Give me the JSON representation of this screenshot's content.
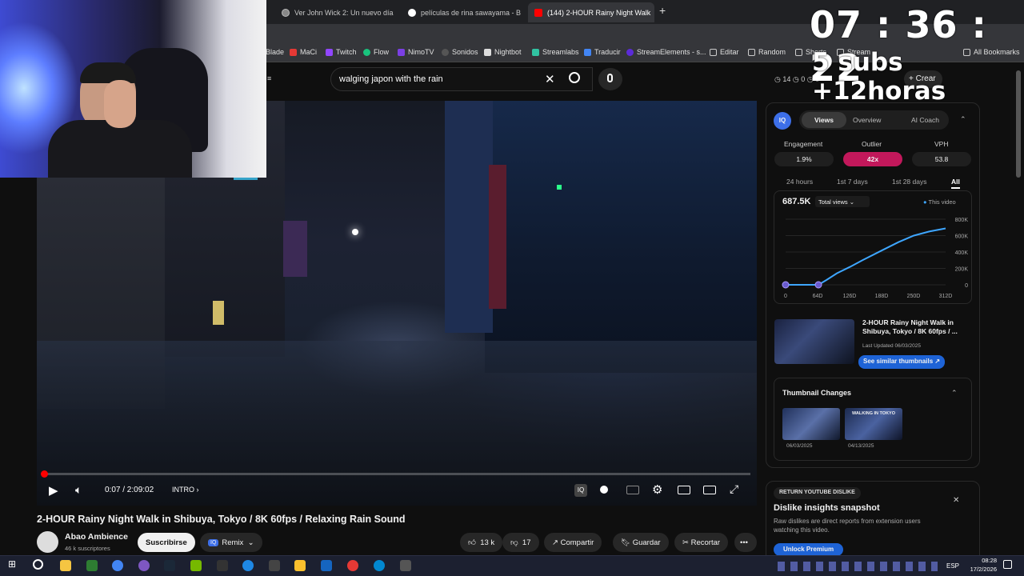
{
  "browser": {
    "tabs": [
      {
        "label": "Ver John Wick 2: Un nuevo día"
      },
      {
        "label": "películas de rina sawayama - B"
      },
      {
        "label": "(144) 2-HOUR Rainy Night Walk"
      }
    ],
    "bookmarks": [
      "Blade",
      "MaCi",
      "Twitch",
      "Flow",
      "NimoTV",
      "Sonidos",
      "Nightbot",
      "Streamlabs",
      "Traducir",
      "StreamElements - s...",
      "Editar",
      "Random",
      "Shorts",
      "Stream"
    ],
    "all_bookmarks": "All Bookmarks"
  },
  "youtube": {
    "search_value": "walging japon with the rain",
    "header_counts": {
      "a": "14",
      "b": "0",
      "c": "0"
    },
    "create_label": "Crear"
  },
  "player": {
    "time": "0:07 / 2:09:02",
    "chapter": "INTRO",
    "progress_fraction": 0.001
  },
  "video": {
    "title": "2-HOUR Rainy Night Walk in Shibuya, Tokyo / 8K 60fps / Relaxing Rain Sound",
    "channel": "Abao Ambience",
    "subscribers": "46 k suscriptores",
    "subscribe_label": "Suscribirse",
    "remix_label": "Remix",
    "likes": "13 k",
    "dislikes": "17",
    "share_label": "Compartir",
    "save_label": "Guardar",
    "clip_label": "Recortar"
  },
  "panel": {
    "logo": "IQ",
    "tabs": [
      "Views",
      "Overview",
      "AI Coach"
    ],
    "metrics": [
      {
        "label": "Engagement",
        "value": "1.9%"
      },
      {
        "label": "Outlier",
        "value": "42x"
      },
      {
        "label": "VPH",
        "value": "53.8"
      }
    ],
    "ranges": [
      "24 hours",
      "1st 7 days",
      "1st 28 days",
      "All"
    ],
    "total": "687.5K",
    "total_select": "Total views",
    "legend": "This video",
    "video_title": "2-HOUR Rainy Night Walk in Shibuya, Tokyo / 8K 60fps / ...",
    "last_updated": "Last Updated 06/03/2025",
    "similar_label": "See similar thumbnails",
    "thumb_changes_title": "Thumbnail Changes",
    "thumb_dates": [
      "06/03/2025",
      "04/13/2025"
    ],
    "thumb_text": "WALKING IN TOKYO"
  },
  "chart_data": {
    "type": "line",
    "x_ticks": [
      "0",
      "64D",
      "126D",
      "188D",
      "250D",
      "312D"
    ],
    "y_ticks": [
      "800K",
      "600K",
      "400K",
      "200K",
      "0"
    ],
    "xlim": [
      0,
      312
    ],
    "ylim": [
      0,
      800000
    ],
    "series": [
      {
        "name": "This video",
        "x": [
          0,
          30,
          64,
          80,
          100,
          126,
          150,
          188,
          220,
          250,
          280,
          312
        ],
        "y": [
          0,
          0,
          0,
          60000,
          140000,
          220000,
          300000,
          420000,
          520000,
          600000,
          650000,
          687500
        ]
      }
    ],
    "color": "#3ea6ff"
  },
  "dislike": {
    "badge": "RETURN YOUTUBE DISLIKE",
    "title": "Dislike insights snapshot",
    "desc": "Raw dislikes are direct reports from extension users watching this video.",
    "cta": "Unlock Premium"
  },
  "overlay": {
    "timer": "07 : 36 : 22",
    "subs": "5 subs +12horas"
  },
  "taskbar": {
    "lang": "ESP",
    "time": "08:28",
    "date": "17/2/2026"
  },
  "colors": {
    "accent_red": "#ff0000",
    "outlier": "#c2185b",
    "link_blue": "#3ea6ff",
    "unlock": "#1e63d6"
  }
}
